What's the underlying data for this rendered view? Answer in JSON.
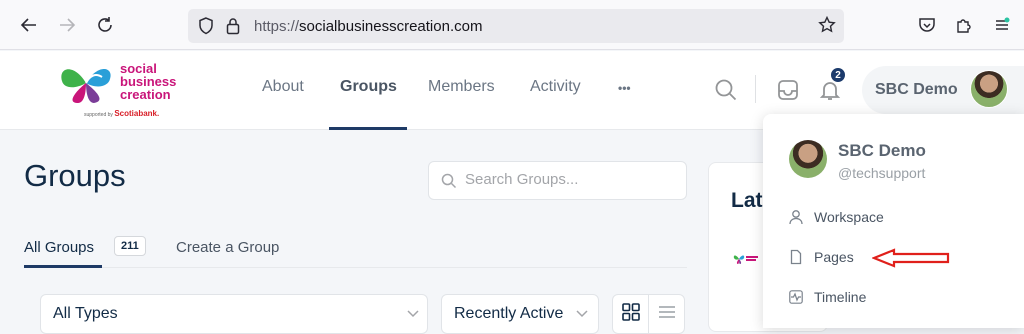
{
  "browser": {
    "url_scheme": "https://",
    "url_host": "socialbusinesscreation.com"
  },
  "logo": {
    "line1": "social",
    "line2": "business",
    "line3": "creation",
    "supported_by": "supported by",
    "sponsor": "Scotiabank."
  },
  "nav": {
    "items": [
      "About",
      "Groups",
      "Members",
      "Activity",
      "•••"
    ],
    "active": "Groups"
  },
  "header": {
    "notification_count": "2",
    "user_name": "SBC Demo"
  },
  "page": {
    "title": "Groups",
    "search_placeholder": "Search Groups...",
    "tabs": {
      "all_label": "All Groups",
      "all_count": "211",
      "create_label": "Create a Group"
    },
    "filter_type": "All Types",
    "filter_order": "Recently Active",
    "latest_title": "Lat"
  },
  "dropdown": {
    "name": "SBC Demo",
    "handle": "@techsupport",
    "items": [
      "Workspace",
      "Pages",
      "Timeline"
    ]
  },
  "colors": {
    "accent": "#1e3a66",
    "annotation_arrow": "#e0201b",
    "logo_pink": "#c9157a"
  }
}
